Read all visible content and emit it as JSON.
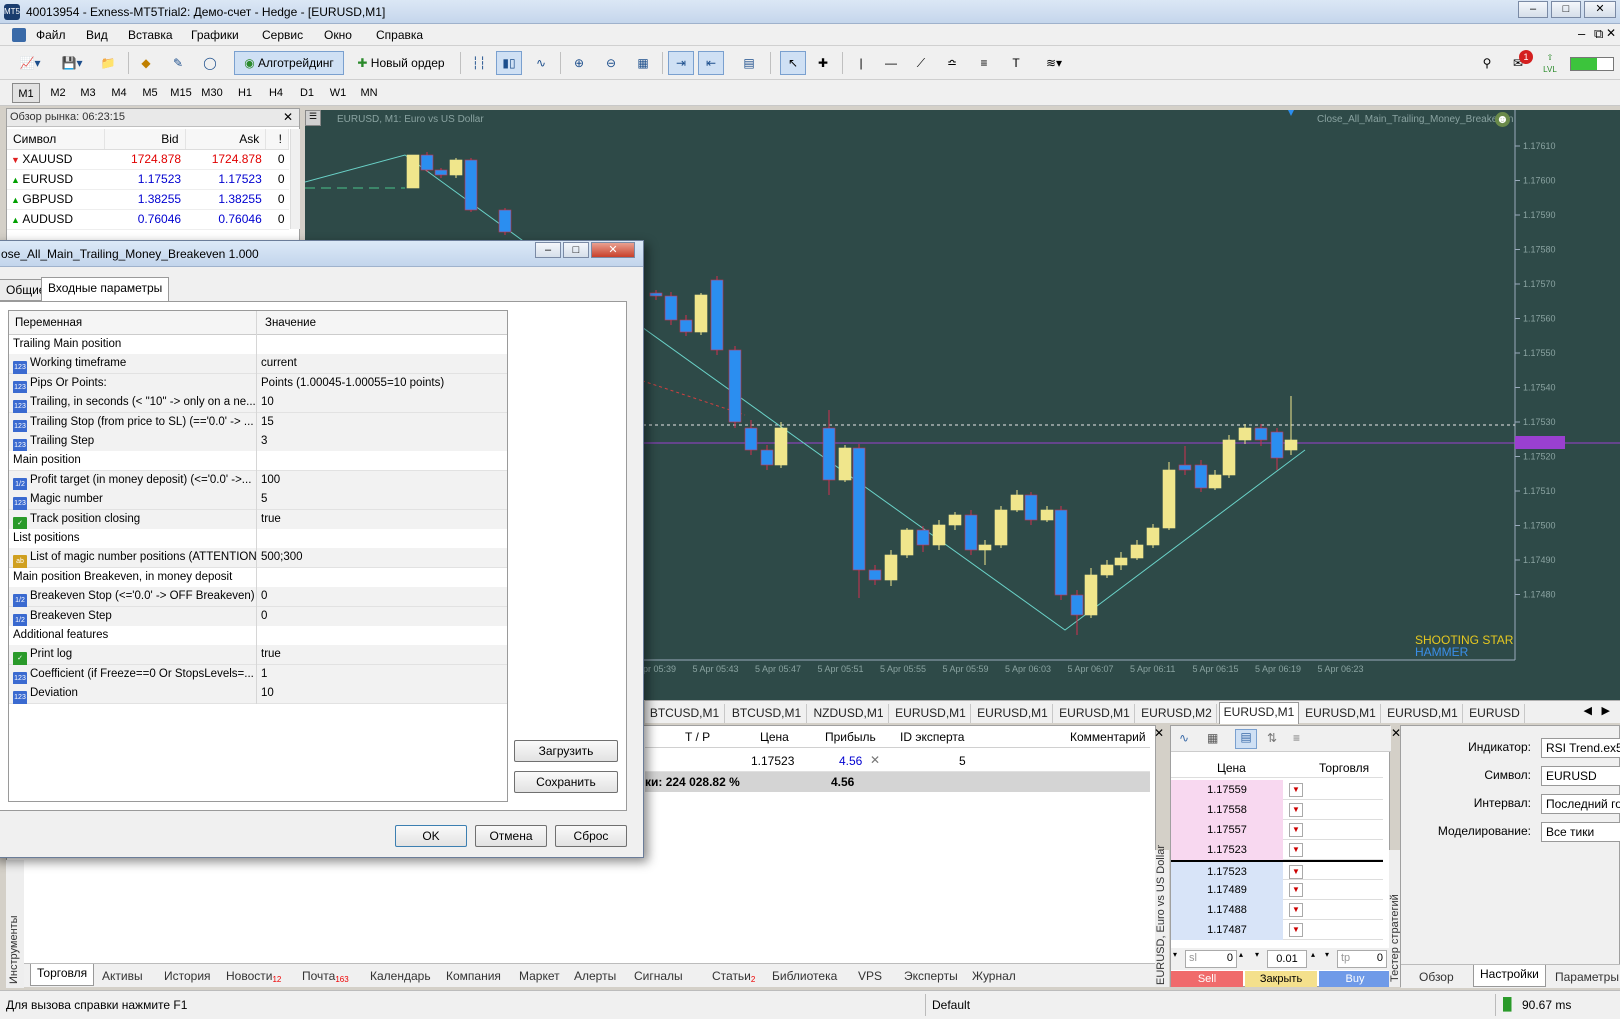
{
  "window": {
    "title": "40013954 - Exness-MT5Trial2: Демо-счет - Hedge - [EURUSD,M1]"
  },
  "menu": [
    "Файл",
    "Вид",
    "Вставка",
    "Графики",
    "Сервис",
    "Окно",
    "Справка"
  ],
  "toolbar": {
    "algo": "Алготрейдинг",
    "new_order": "Новый ордер",
    "notif_count": "1",
    "lvl": "LVL"
  },
  "timeframes": [
    "M1",
    "M2",
    "M3",
    "M4",
    "M5",
    "M15",
    "M30",
    "H1",
    "H4",
    "D1",
    "W1",
    "MN"
  ],
  "market_watch": {
    "title": "Обзор рынка: 06:23:15",
    "headers": [
      "Символ",
      "Bid",
      "Ask",
      "!"
    ],
    "rows": [
      {
        "sym": "XAUUSD",
        "bid": "1724.878",
        "ask": "1724.878",
        "n": "0",
        "dir": "down"
      },
      {
        "sym": "EURUSD",
        "bid": "1.17523",
        "ask": "1.17523",
        "n": "0",
        "dir": "up"
      },
      {
        "sym": "GBPUSD",
        "bid": "1.38255",
        "ask": "1.38255",
        "n": "0",
        "dir": "up"
      },
      {
        "sym": "AUDUSD",
        "bid": "0.76046",
        "ask": "0.76046",
        "n": "0",
        "dir": "up"
      }
    ]
  },
  "chart": {
    "title": "EURUSD, M1:  Euro vs US Dollar",
    "ea": "Close_All_Main_Trailing_Money_Breakeven",
    "price_labels": [
      "1.17610",
      "1.17600",
      "1.17590",
      "1.17580",
      "1.17570",
      "1.17560",
      "1.17550",
      "1.17540",
      "1.17530",
      "1.17520",
      "1.17510",
      "1.17500",
      "1.17490",
      "1.17480"
    ],
    "time_labels": [
      "5 Apr 05:39",
      "5 Apr 05:43",
      "5 Apr 05:47",
      "5 Apr 05:51",
      "5 Apr 05:55",
      "5 Apr 05:59",
      "5 Apr 06:03",
      "5 Apr 06:07",
      "5 Apr 06:11",
      "5 Apr 06:15",
      "5 Apr 06:19",
      "5 Apr 06:23"
    ],
    "pattern1": "SHOOTING STAR",
    "pattern2": "HAMMER"
  },
  "chart_tabs": [
    "BTCUSD,M1",
    "BTCUSD,M1",
    "NZDUSD,M1",
    "EURUSD,M1",
    "EURUSD,M1",
    "EURUSD,M1",
    "EURUSD,M2",
    "EURUSD,M1",
    "EURUSD,M1",
    "EURUSD,M1",
    "EURUSD"
  ],
  "trade": {
    "headers": [
      "T / P",
      "Цена",
      "Прибыль",
      "ID эксперта",
      "Комментарий"
    ],
    "row": {
      "price": "1.17523",
      "profit": "4.56",
      "id": "5"
    },
    "summary_label": "ки: 224 028.82 %",
    "summary_profit": "4.56"
  },
  "dialog": {
    "title": "ose_All_Main_Trailing_Money_Breakeven 1.000",
    "tabs": [
      "Общие",
      "Входные параметры"
    ],
    "col_var": "Переменная",
    "col_val": "Значение",
    "rows": [
      {
        "name": "Trailing Main position",
        "value": "",
        "type": "group"
      },
      {
        "name": "Working timeframe",
        "value": "current",
        "type": "int"
      },
      {
        "name": "Pips Or Points:",
        "value": "Points (1.00045-1.00055=10 points)",
        "type": "int"
      },
      {
        "name": "Trailing, in seconds (< \"10\" -> only on a ne...",
        "value": "10",
        "type": "int"
      },
      {
        "name": "Trailing Stop (from price to SL) (=='0.0' -> ...",
        "value": "15",
        "type": "int"
      },
      {
        "name": "Trailing Step",
        "value": "3",
        "type": "int"
      },
      {
        "name": "Main position",
        "value": "",
        "type": "group"
      },
      {
        "name": "Profit target (in money deposit) (<='0.0' ->...",
        "value": "100",
        "type": "dbl"
      },
      {
        "name": "Magic number",
        "value": "5",
        "type": "int"
      },
      {
        "name": "Track position closing",
        "value": "true",
        "type": "bool"
      },
      {
        "name": "List positions",
        "value": "",
        "type": "group"
      },
      {
        "name": "List of magic number positions (ATTENTION:...",
        "value": "500;300",
        "type": "str"
      },
      {
        "name": "Main position Breakeven, in money deposit",
        "value": "",
        "type": "group"
      },
      {
        "name": "Breakeven Stop (<='0.0' -> OFF Breakeven)",
        "value": "0",
        "type": "dbl"
      },
      {
        "name": "Breakeven Step",
        "value": "0",
        "type": "dbl"
      },
      {
        "name": "Additional features",
        "value": "",
        "type": "group"
      },
      {
        "name": "Print log",
        "value": "true",
        "type": "bool"
      },
      {
        "name": "Coefficient (if Freeze==0 Or StopsLevels=...",
        "value": "1",
        "type": "int"
      },
      {
        "name": "Deviation",
        "value": "10",
        "type": "int"
      }
    ],
    "load": "Загрузить",
    "save": "Сохранить",
    "ok": "OK",
    "cancel": "Отмена",
    "reset": "Сброс"
  },
  "depth": {
    "col_price": "Цена",
    "col_trade": "Торговля",
    "asks": [
      "1.17559",
      "1.17558",
      "1.17557",
      "1.17523"
    ],
    "bids": [
      "1.17523",
      "1.17489",
      "1.17488",
      "1.17487"
    ],
    "sl": "sl",
    "sl_val": "0",
    "lot": "0.01",
    "tp": "tp",
    "tp_val": "0",
    "sell": "Sell",
    "close": "Закрыть",
    "buy": "Buy",
    "vertical": "EURUSD, Euro vs US Dollar"
  },
  "tester": {
    "vertical": "Тестер стратегий",
    "rows": [
      {
        "label": "Индикатор:",
        "value": "RSI Trend.ex5"
      },
      {
        "label": "Символ:",
        "value": "EURUSD"
      },
      {
        "label": "Интервал:",
        "value": "Последний го"
      },
      {
        "label": "Моделирование:",
        "value": "Все тики"
      }
    ],
    "tabs": [
      "Обзор",
      "Настройки",
      "Параметры"
    ]
  },
  "toolbox": {
    "vertical": "Инструменты",
    "tabs": [
      {
        "label": "Торговля",
        "badge": ""
      },
      {
        "label": "Активы",
        "badge": ""
      },
      {
        "label": "История",
        "badge": ""
      },
      {
        "label": "Новости",
        "badge": "12"
      },
      {
        "label": "Почта",
        "badge": "163"
      },
      {
        "label": "Календарь",
        "badge": ""
      },
      {
        "label": "Компания",
        "badge": ""
      },
      {
        "label": "Маркет",
        "badge": ""
      },
      {
        "label": "Алерты",
        "badge": ""
      },
      {
        "label": "Сигналы",
        "badge": ""
      },
      {
        "label": "Статьи",
        "badge": "2"
      },
      {
        "label": "Библиотека",
        "badge": ""
      },
      {
        "label": "VPS",
        "badge": ""
      },
      {
        "label": "Эксперты",
        "badge": ""
      },
      {
        "label": "Журнал",
        "badge": ""
      }
    ]
  },
  "status": {
    "help": "Для вызова справки нажмите F1",
    "profile": "Default",
    "ping": "90.67 ms"
  }
}
